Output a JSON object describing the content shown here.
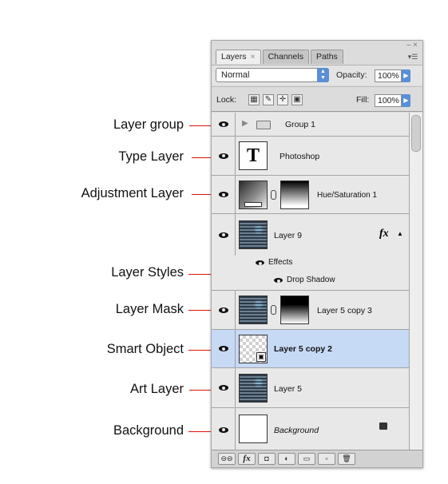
{
  "callouts": [
    "Layer group",
    "Type Layer",
    "Adjustment Layer",
    "Layer Styles",
    "Layer Mask",
    "Smart Object",
    "Art Layer",
    "Background"
  ],
  "panel": {
    "tabs": [
      {
        "label": "Layers",
        "close": "×"
      },
      {
        "label": "Channels"
      },
      {
        "label": "Paths"
      }
    ],
    "window_controls": "– ×",
    "menu_icon": "▾☰",
    "blend_mode": "Normal",
    "opacity_label": "Opacity:",
    "opacity_value": "100%",
    "lock_label": "Lock:",
    "fill_label": "Fill:",
    "fill_value": "100%"
  },
  "layers": [
    {
      "name": "Group 1"
    },
    {
      "name": "Photoshop",
      "glyph": "T"
    },
    {
      "name": "Hue/Saturation 1"
    },
    {
      "name": "Layer 9",
      "fx": "fx",
      "effects_label": "Effects",
      "effect_item": "Drop Shadow"
    },
    {
      "name": "Layer 5 copy 3"
    },
    {
      "name": "Layer 5 copy 2"
    },
    {
      "name": "Layer 5"
    },
    {
      "name": "Background"
    }
  ],
  "colors": {
    "callout_arrow": "#e01010",
    "selected_row": "#c6d9f5",
    "accent_blue": "#5a8fd6"
  }
}
